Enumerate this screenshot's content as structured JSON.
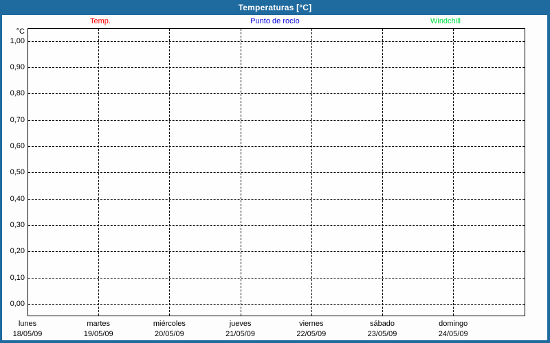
{
  "window": {
    "title": "Temperaturas [°C]"
  },
  "legend": {
    "items": [
      {
        "label": "Temp.",
        "color": "#ff0000"
      },
      {
        "label": "Punto de rocío",
        "color": "#0000dd"
      },
      {
        "label": "Windchill",
        "color": "#00dd44"
      }
    ]
  },
  "chart_data": {
    "type": "line",
    "title": "Temperaturas [°C]",
    "xlabel": "",
    "ylabel": "°C",
    "ylim": [
      0.0,
      1.0
    ],
    "y_tick_step": 0.1,
    "grid": "dashed",
    "legend_position": "top",
    "y_ticks": [
      {
        "value": 1.0,
        "label": "1,00"
      },
      {
        "value": 0.9,
        "label": "0,90"
      },
      {
        "value": 0.8,
        "label": "0,80"
      },
      {
        "value": 0.7,
        "label": "0,70"
      },
      {
        "value": 0.6,
        "label": "0,60"
      },
      {
        "value": 0.5,
        "label": "0,50"
      },
      {
        "value": 0.4,
        "label": "0,40"
      },
      {
        "value": 0.3,
        "label": "0,30"
      },
      {
        "value": 0.2,
        "label": "0,20"
      },
      {
        "value": 0.1,
        "label": "0,10"
      },
      {
        "value": 0.0,
        "label": "0,00"
      }
    ],
    "x_categories": [
      {
        "day": "lunes",
        "date": "18/05/09"
      },
      {
        "day": "martes",
        "date": "19/05/09"
      },
      {
        "day": "miércoles",
        "date": "20/05/09"
      },
      {
        "day": "jueves",
        "date": "21/05/09"
      },
      {
        "day": "viernes",
        "date": "22/05/09"
      },
      {
        "day": "sábado",
        "date": "23/05/09"
      },
      {
        "day": "domingo",
        "date": "24/05/09"
      }
    ],
    "series": [
      {
        "name": "Temp.",
        "color": "#ff0000",
        "values": []
      },
      {
        "name": "Punto de rocío",
        "color": "#0000dd",
        "values": []
      },
      {
        "name": "Windchill",
        "color": "#00dd44",
        "values": []
      }
    ]
  },
  "colors": {
    "titlebar_bg": "#1f6a9e",
    "frame_border": "#1f6a9e",
    "title_text": "#ffffff",
    "plot_border": "#000000",
    "gridline": "#000000",
    "axis_text": "#000000",
    "background": "#fdfdfd",
    "plot_background": "#fefefe"
  }
}
